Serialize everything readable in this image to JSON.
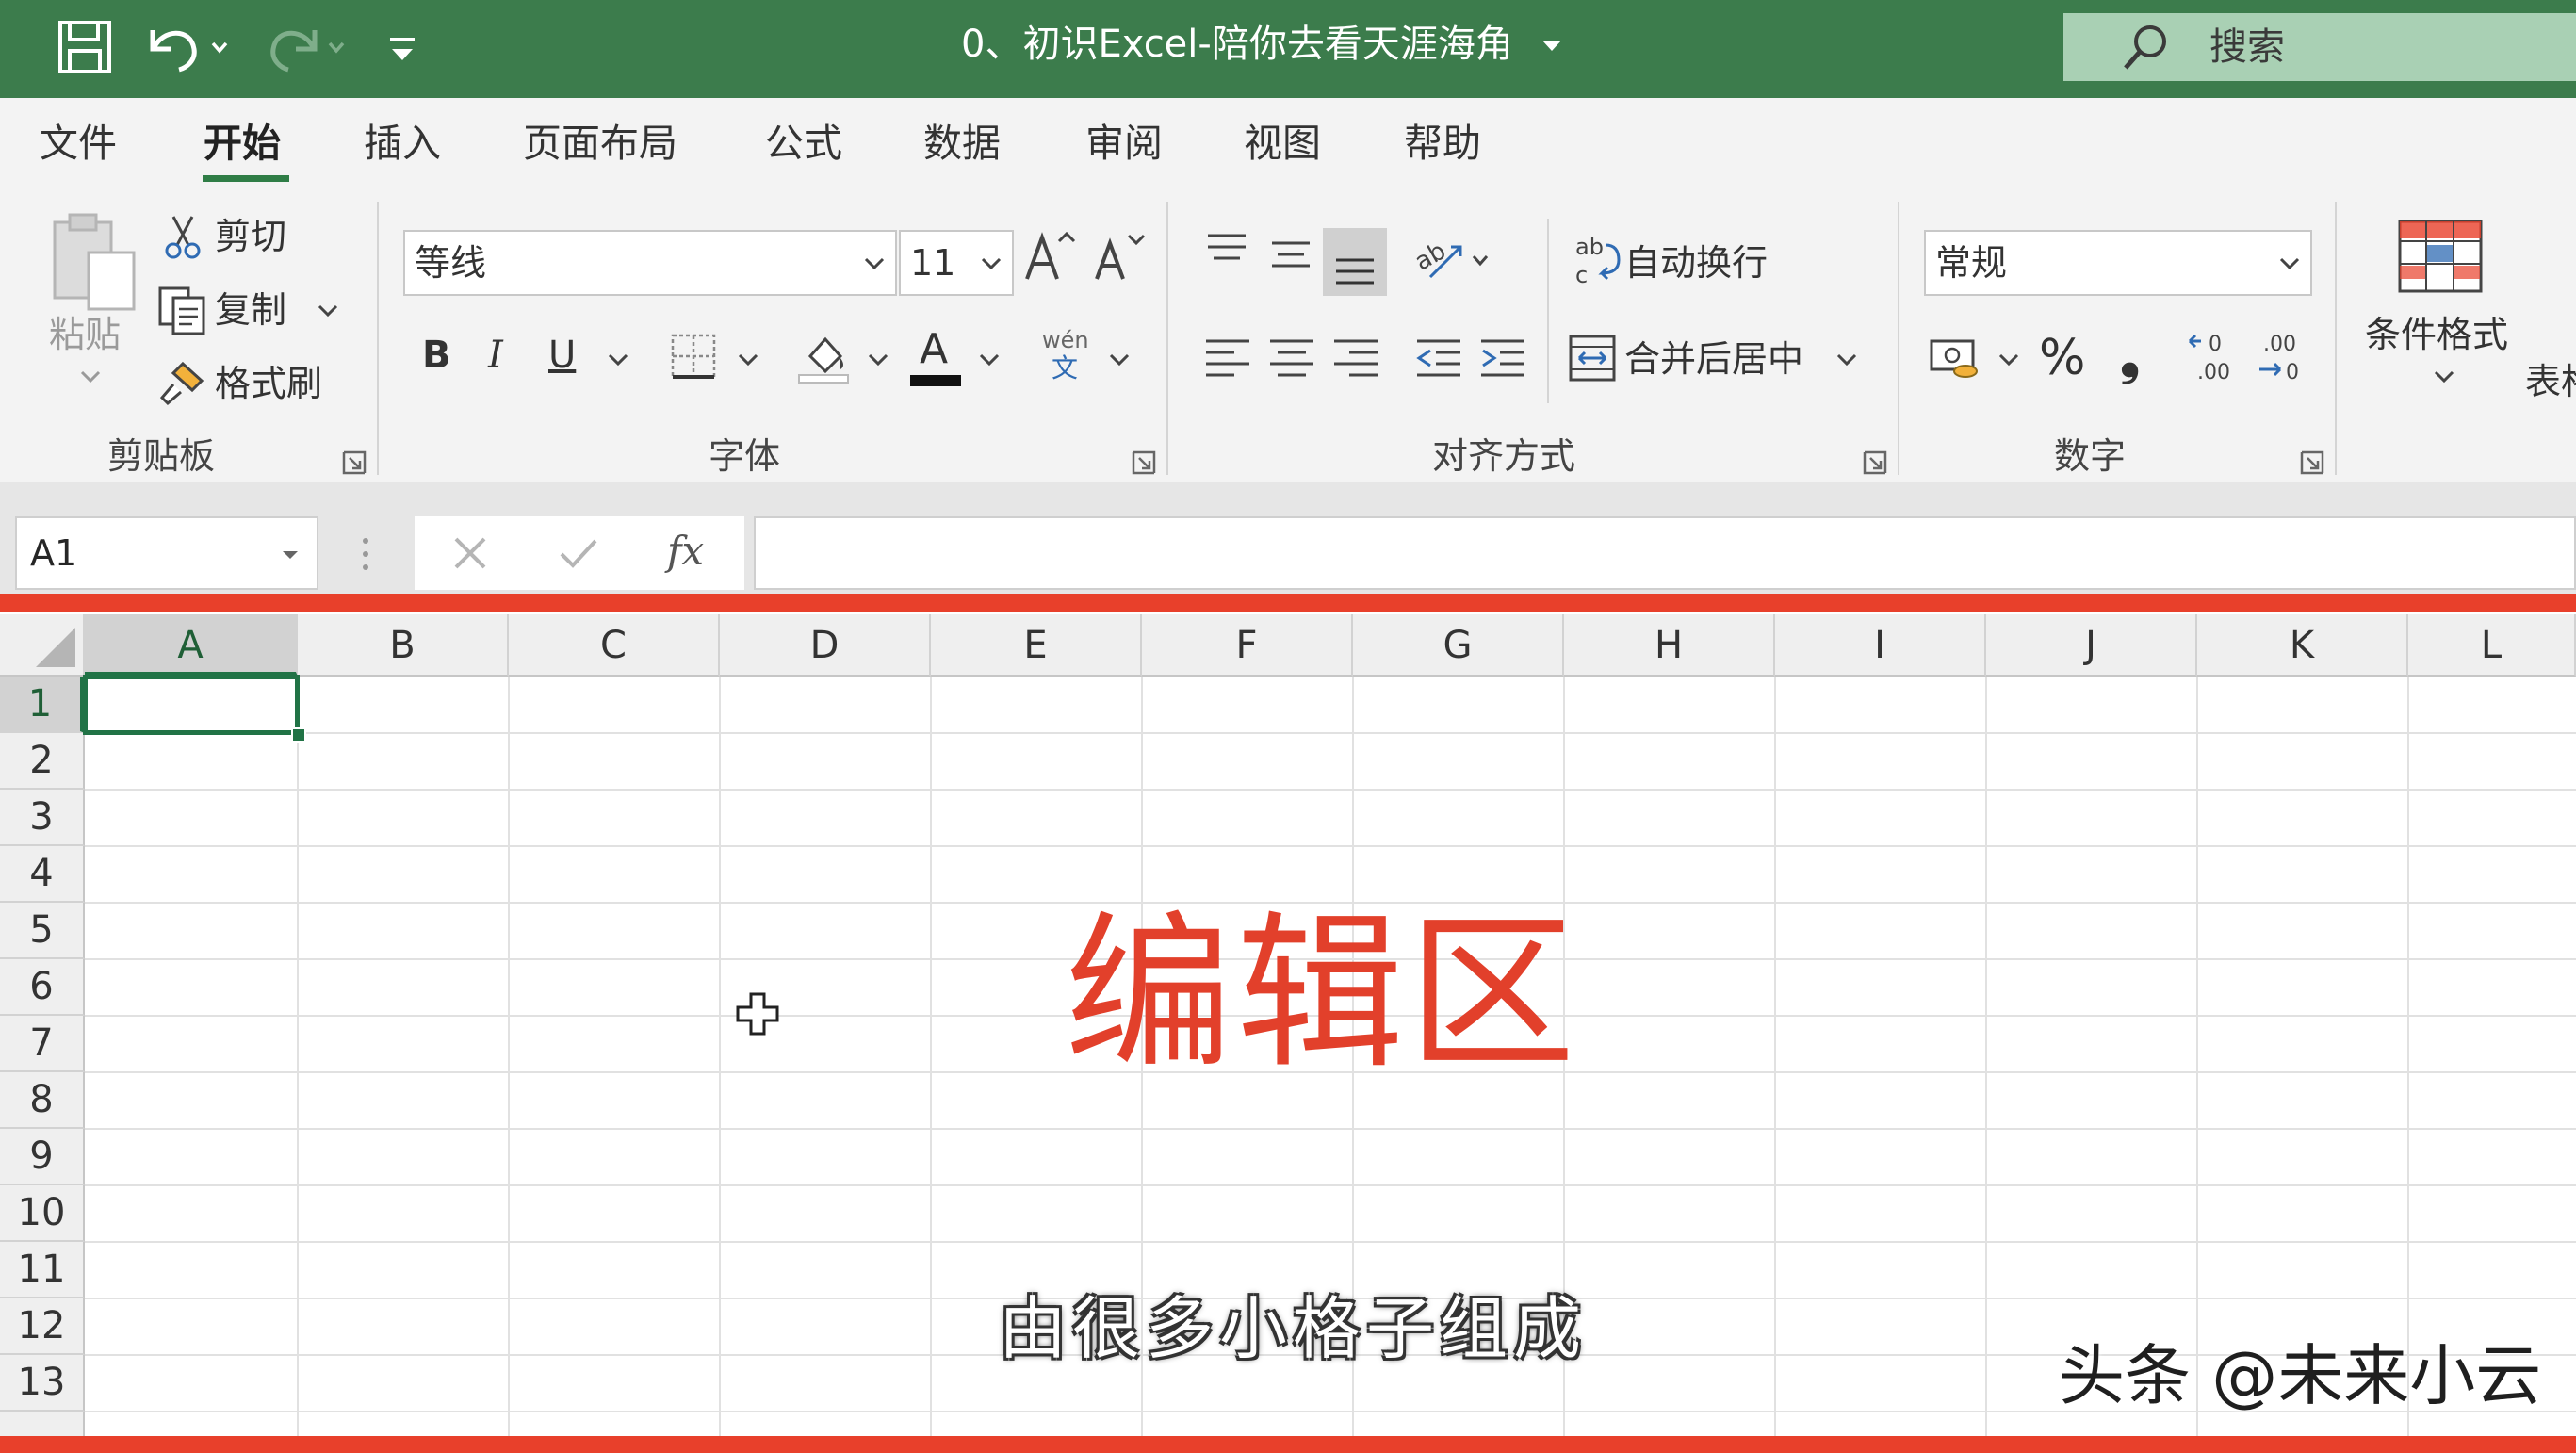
{
  "colors": {
    "title_bar": "#3c7c4c",
    "accent_green": "#217346",
    "red_highlight": "#e8402b",
    "overlay_title": "#e2402b"
  },
  "titlebar": {
    "document_title": "0、初识Excel-陪你去看天涯海角",
    "search_placeholder": "搜索"
  },
  "quick_access": {
    "icons": [
      "save-icon",
      "undo-icon",
      "redo-icon",
      "customize-icon"
    ]
  },
  "tabs": [
    {
      "label": "文件"
    },
    {
      "label": "开始",
      "active": true
    },
    {
      "label": "插入"
    },
    {
      "label": "页面布局"
    },
    {
      "label": "公式"
    },
    {
      "label": "数据"
    },
    {
      "label": "审阅"
    },
    {
      "label": "视图"
    },
    {
      "label": "帮助"
    }
  ],
  "clipboard": {
    "paste": "粘贴",
    "cut": "剪切",
    "copy": "复制",
    "format_painter": "格式刷",
    "group_label": "剪贴板"
  },
  "font": {
    "name": "等线",
    "size": "11",
    "bold": "B",
    "italic": "I",
    "underline": "U",
    "color_letter": "A",
    "phonetic_top": "wén",
    "phonetic_bottom": "文",
    "group_label": "字体"
  },
  "alignment": {
    "wrap_text": "自动换行",
    "merge_center": "合并后居中",
    "group_label": "对齐方式"
  },
  "number": {
    "format": "常规",
    "percent": "%",
    "comma": "❟",
    "group_label": "数字"
  },
  "styles": {
    "conditional_formatting": "条件格式",
    "partial_label": "表格"
  },
  "formula_bar": {
    "name_box": "A1",
    "fx": "fx",
    "value": ""
  },
  "grid": {
    "columns": [
      "A",
      "B",
      "C",
      "D",
      "E",
      "F",
      "G",
      "H",
      "I",
      "J",
      "K",
      "L"
    ],
    "rows": [
      "1",
      "2",
      "3",
      "4",
      "5",
      "6",
      "7",
      "8",
      "9",
      "10",
      "11",
      "12",
      "13"
    ],
    "active_cell": "A1"
  },
  "overlay": {
    "title": "编辑区",
    "subtitle": "由很多小格子组成",
    "watermark": "头条 @未来小云"
  }
}
